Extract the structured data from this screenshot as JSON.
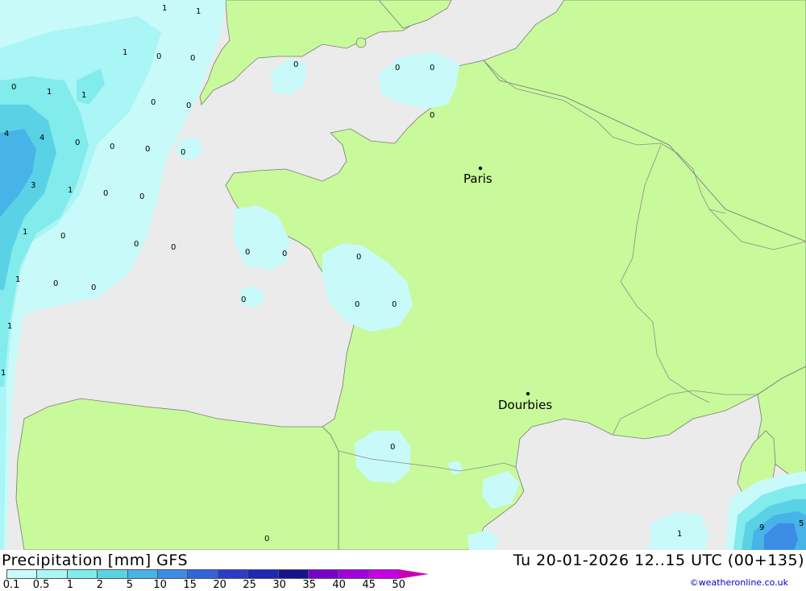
{
  "legend": {
    "title": "Precipitation [mm] GFS",
    "run_info": "Tu 20-01-2026 12..15 UTC (00+135)",
    "credit": "©weatheronline.co.uk",
    "colors": [
      "#c8fafa",
      "#aaf5f5",
      "#82ebeb",
      "#5ad2e6",
      "#46b4e6",
      "#3c8ce6",
      "#3264dc",
      "#283cc8",
      "#1e28b4",
      "#14148c",
      "#7800c8",
      "#a000dc",
      "#c800e6",
      "#e600e6",
      "#c800b4"
    ],
    "labels": [
      "0.1",
      "0.5",
      "1",
      "2",
      "5",
      "10",
      "15",
      "20",
      "25",
      "30",
      "35",
      "40",
      "45",
      "50"
    ]
  },
  "cities": [
    {
      "name": "Paris"
    },
    {
      "name": "Dourbies"
    }
  ],
  "grid_values": [
    {
      "v": "1"
    },
    {
      "v": "1"
    },
    {
      "v": "1"
    },
    {
      "v": "0"
    },
    {
      "v": "0"
    },
    {
      "v": "0"
    },
    {
      "v": "1"
    },
    {
      "v": "1"
    },
    {
      "v": "0"
    },
    {
      "v": "0"
    },
    {
      "v": "0"
    },
    {
      "v": "0"
    },
    {
      "v": "0"
    },
    {
      "v": "4"
    },
    {
      "v": "4"
    },
    {
      "v": "0"
    },
    {
      "v": "0"
    },
    {
      "v": "0"
    },
    {
      "v": "0"
    },
    {
      "v": "3"
    },
    {
      "v": "1"
    },
    {
      "v": "0"
    },
    {
      "v": "0"
    },
    {
      "v": "1"
    },
    {
      "v": "0"
    },
    {
      "v": "0"
    },
    {
      "v": "0"
    },
    {
      "v": "0"
    },
    {
      "v": "0"
    },
    {
      "v": "0"
    },
    {
      "v": "1"
    },
    {
      "v": "0"
    },
    {
      "v": "0"
    },
    {
      "v": "0"
    },
    {
      "v": "0"
    },
    {
      "v": "0"
    },
    {
      "v": "1"
    },
    {
      "v": "1"
    },
    {
      "v": "0"
    },
    {
      "v": "0"
    },
    {
      "v": "0"
    },
    {
      "v": "1"
    },
    {
      "v": "9"
    },
    {
      "v": "5"
    }
  ]
}
